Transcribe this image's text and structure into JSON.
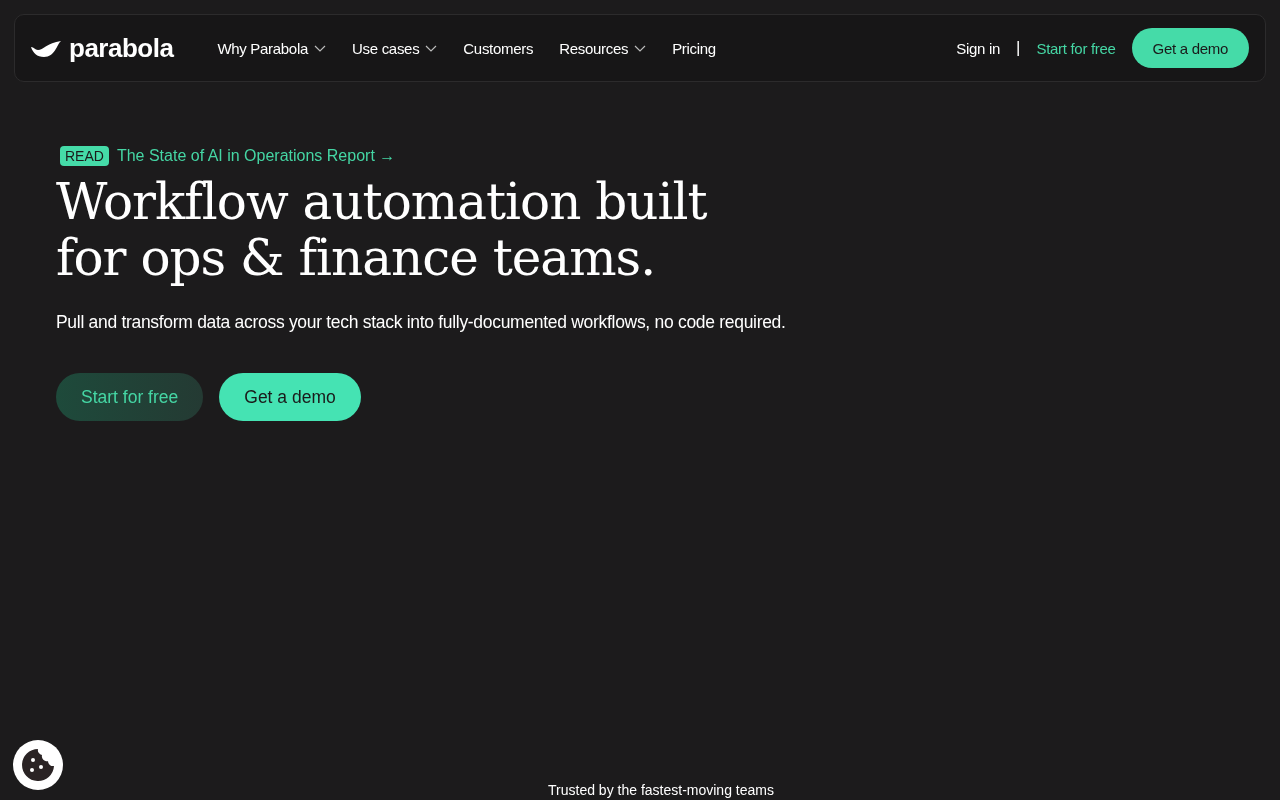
{
  "nav": {
    "logo": "parabola",
    "items": [
      {
        "label": "Why Parabola",
        "has_menu": true
      },
      {
        "label": "Use cases",
        "has_menu": true
      },
      {
        "label": "Customers",
        "has_menu": false
      },
      {
        "label": "Resources",
        "has_menu": true
      },
      {
        "label": "Pricing",
        "has_menu": false
      }
    ],
    "sign_in": "Sign in",
    "separator": "|",
    "start": "Start for free",
    "demo": "Get a demo"
  },
  "hero": {
    "badge": "READ",
    "announcement": "The State of AI in Operations Report →",
    "headline": [
      "Workflow automation built",
      "for ops & finance teams."
    ],
    "subtitle": "Pull and transform data across your tech stack into fully-documented workflows, no code required.",
    "buttons": [
      {
        "label": "Start for free",
        "kind": "dark"
      },
      {
        "label": "Get a demo",
        "kind": "mint"
      }
    ]
  },
  "trusted": "Trusted by the fastest-moving teams"
}
